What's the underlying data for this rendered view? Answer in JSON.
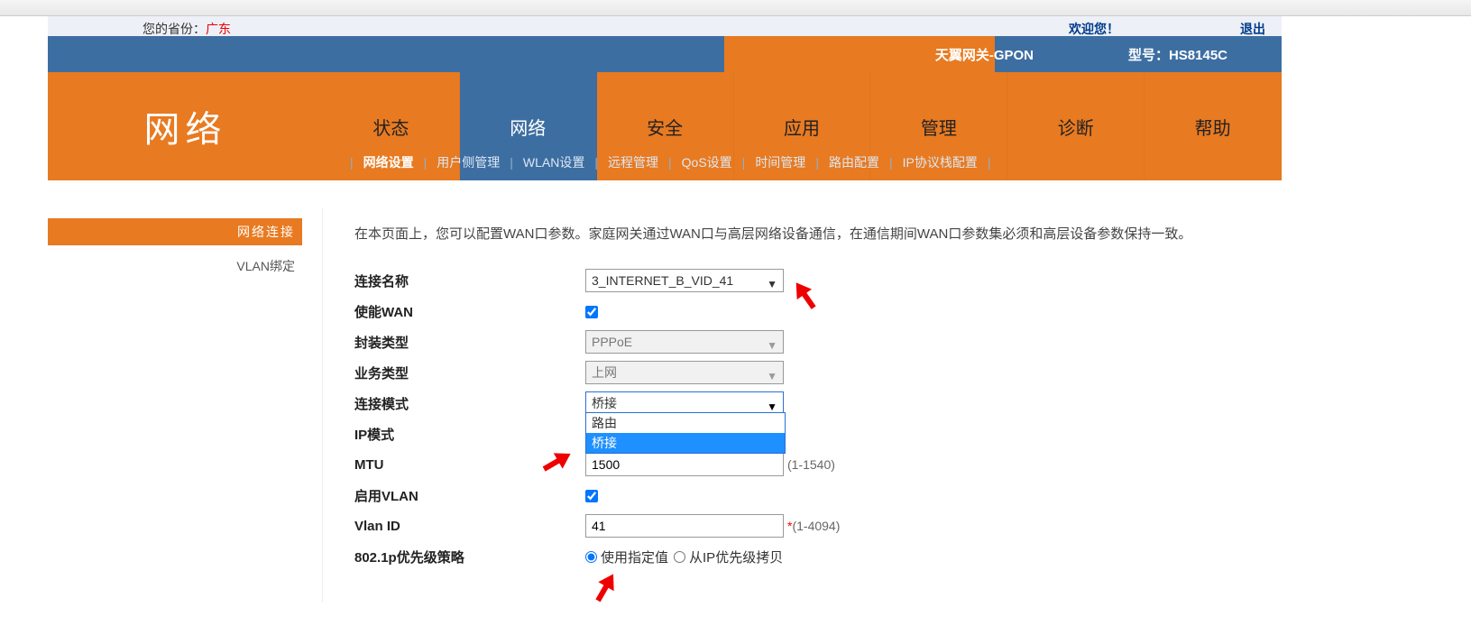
{
  "topbar": {
    "province_label": "您的省份：",
    "province_value": "广东",
    "welcome": "欢迎您！",
    "logout": "退出"
  },
  "blueband": {
    "product": "天翼网关-GPON",
    "model_label": "型号：",
    "model_value": "HS8145C"
  },
  "bigtitle": "网络",
  "tabs": [
    {
      "label": "状态"
    },
    {
      "label": "网络"
    },
    {
      "label": "安全"
    },
    {
      "label": "应用"
    },
    {
      "label": "管理"
    },
    {
      "label": "诊断"
    },
    {
      "label": "帮助"
    }
  ],
  "submenu": [
    {
      "label": "网络设置",
      "active": true
    },
    {
      "label": "用户侧管理"
    },
    {
      "label": "WLAN设置"
    },
    {
      "label": "远程管理"
    },
    {
      "label": "QoS设置"
    },
    {
      "label": "时间管理"
    },
    {
      "label": "路由配置"
    },
    {
      "label": "IP协议栈配置"
    }
  ],
  "sidebar": {
    "header": "网络连接",
    "items": [
      {
        "label": "VLAN绑定"
      }
    ]
  },
  "description": "在本页面上，您可以配置WAN口参数。家庭网关通过WAN口与高层网络设备通信，在通信期间WAN口参数集必须和高层设备参数保持一致。",
  "fields": {
    "conn_name": {
      "label": "连接名称",
      "value": "3_INTERNET_B_VID_41"
    },
    "enable_wan": {
      "label": "使能WAN",
      "checked": true
    },
    "encap_type": {
      "label": "封装类型",
      "value": "PPPoE"
    },
    "service_type": {
      "label": "业务类型",
      "value": "上网"
    },
    "conn_mode": {
      "label": "连接模式",
      "value": "桥接",
      "options": [
        "路由",
        "桥接"
      ]
    },
    "ip_mode": {
      "label": "IP模式"
    },
    "mtu": {
      "label": "MTU",
      "value": "1500",
      "hint": "(1-1540)"
    },
    "enable_vlan": {
      "label": "启用VLAN",
      "checked": true
    },
    "vlan_id": {
      "label": "Vlan ID",
      "value": "41",
      "hint": "(1-4094)",
      "required": true
    },
    "dot1p": {
      "label": "802.1p优先级策略",
      "opt1": "使用指定值",
      "opt2": "从IP优先级拷贝",
      "selected": "opt1"
    }
  }
}
